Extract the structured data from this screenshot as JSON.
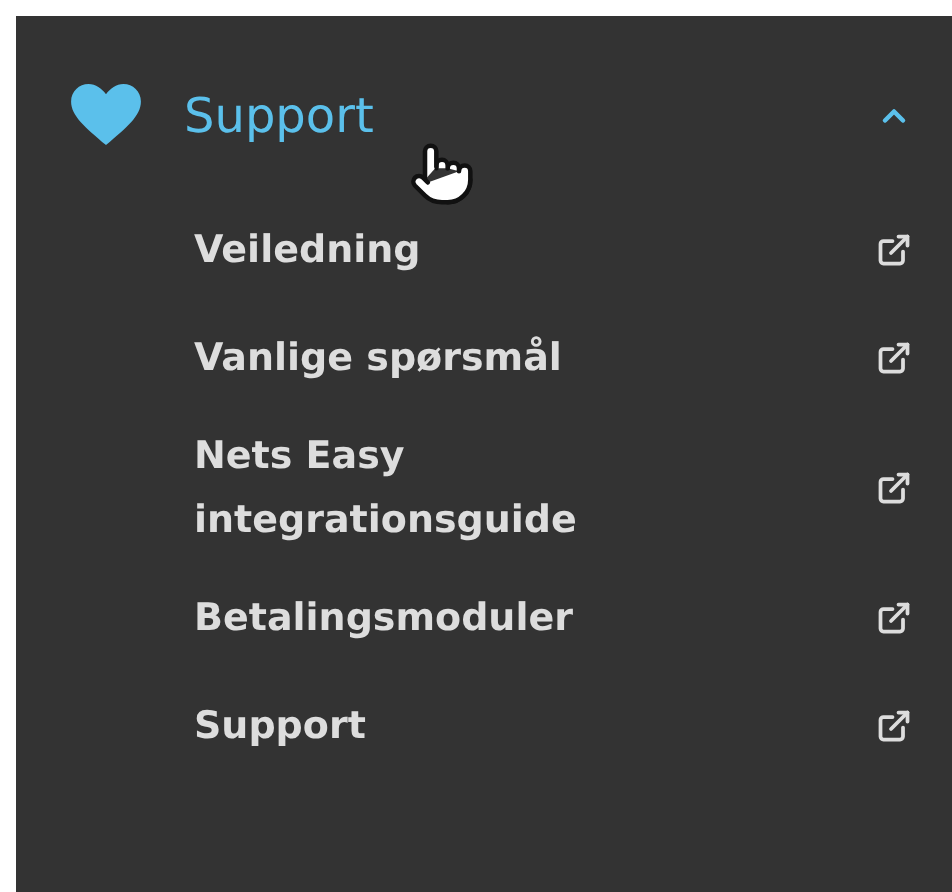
{
  "menu": {
    "title": "Support",
    "expanded": true,
    "items": [
      {
        "label": "Veiledning"
      },
      {
        "label": "Vanlige spørsmål"
      },
      {
        "label": "Nets Easy integrationsguide"
      },
      {
        "label": "Betalingsmoduler"
      },
      {
        "label": "Support"
      }
    ]
  }
}
